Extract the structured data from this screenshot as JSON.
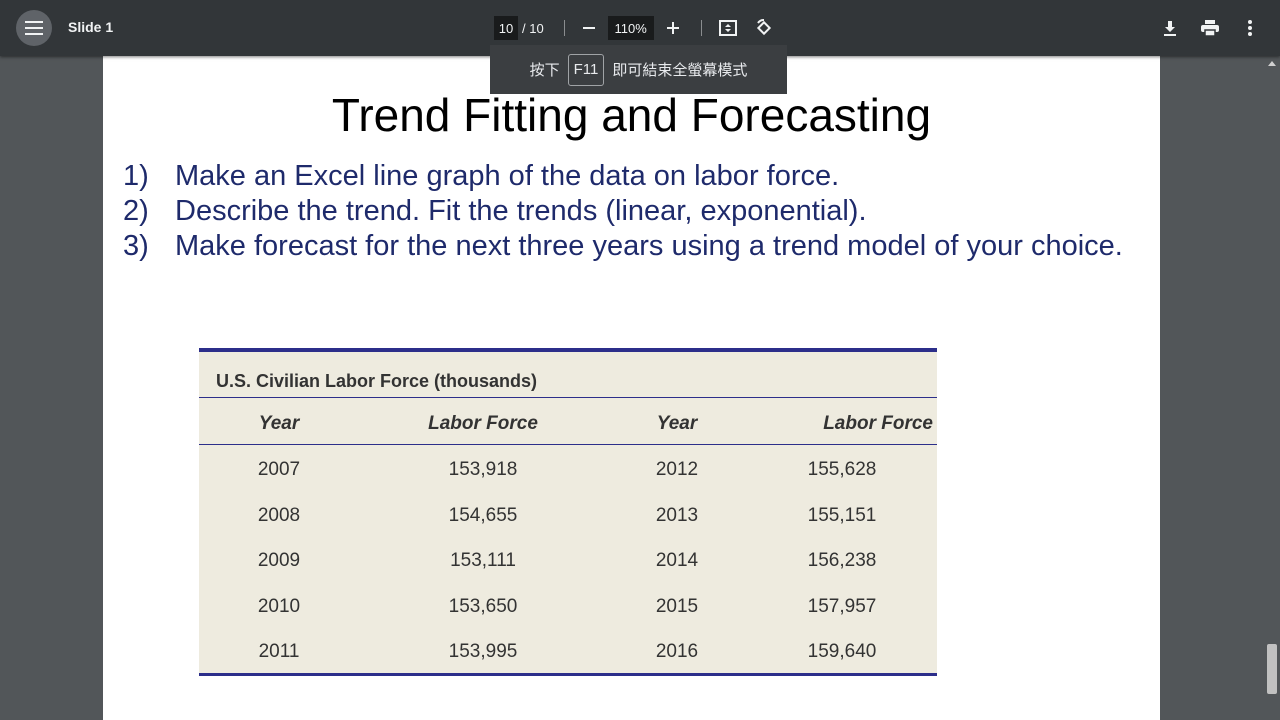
{
  "toolbar": {
    "title": "Slide 1",
    "page_current": "10",
    "page_total": "/ 10",
    "zoom": "110%"
  },
  "fullscreen_hint": {
    "before": "按下",
    "key": "F11",
    "after": "即可結束全螢幕模式"
  },
  "slide": {
    "title": "Trend Fitting and Forecasting",
    "items": [
      {
        "num": "1)",
        "text": "Make an Excel line graph of the data on labor force."
      },
      {
        "num": "2)",
        "text": "Describe the trend. Fit the trends (linear, exponential)."
      },
      {
        "num": "3)",
        "text": "Make forecast for the next three years using a trend model of your choice."
      }
    ]
  },
  "table": {
    "caption": "U.S. Civilian Labor Force (thousands)",
    "headers": [
      "Year",
      "Labor Force",
      "Year",
      "Labor Force"
    ],
    "rows": [
      [
        "2007",
        "153,918",
        "2012",
        "155,628"
      ],
      [
        "2008",
        "154,655",
        "2013",
        "155,151"
      ],
      [
        "2009",
        "153,111",
        "2014",
        "156,238"
      ],
      [
        "2010",
        "153,650",
        "2015",
        "157,957"
      ],
      [
        "2011",
        "153,995",
        "2016",
        "159,640"
      ]
    ]
  },
  "icons": {
    "menu": "menu-icon",
    "zoom_out": "minus-icon",
    "zoom_in": "plus-icon",
    "fit": "fit-page-icon",
    "rotate": "rotate-icon",
    "download": "download-icon",
    "print": "print-icon",
    "more": "more-vert-icon"
  },
  "colors": {
    "toolbar": "#323639",
    "background": "#525659",
    "list_text": "#1e2a6b",
    "table_border": "#2c2e8a",
    "table_bg": "#eeebdf"
  }
}
